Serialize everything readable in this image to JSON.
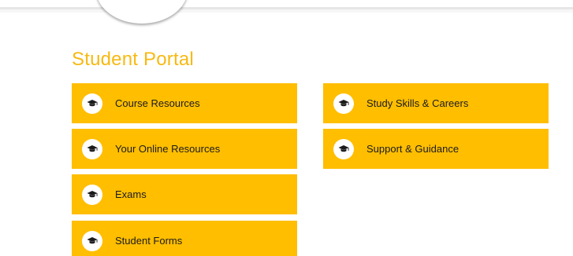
{
  "portal": {
    "title": "Student Portal",
    "accent_color": "#ffbe00",
    "title_color": "#f7b912",
    "tile_icon": "graduation-cap-icon"
  },
  "tiles": [
    {
      "label": "Course Resources"
    },
    {
      "label": "Your Online Resources"
    },
    {
      "label": "Exams"
    },
    {
      "label": "Student Forms"
    },
    {
      "label": "Study Skills & Careers"
    },
    {
      "label": "Support & Guidance"
    }
  ]
}
